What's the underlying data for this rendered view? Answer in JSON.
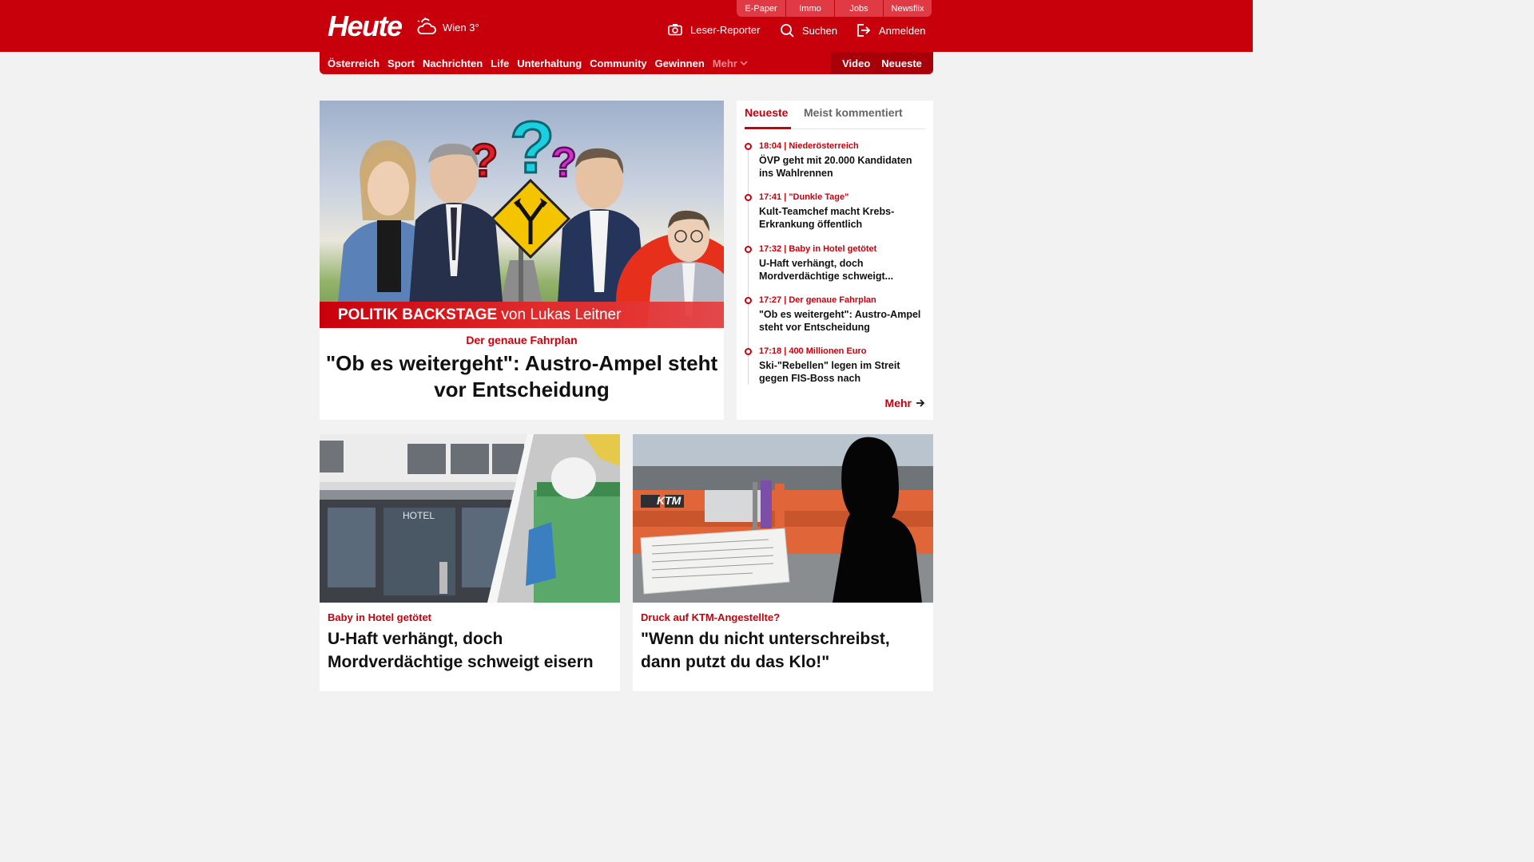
{
  "header": {
    "logo": "Heute",
    "weather": "Wien 3°",
    "weather_icon": "cloud-sun-icon",
    "top_links": [
      "E-Paper",
      "Immo",
      "Jobs",
      "Newsflix"
    ],
    "actions": {
      "reporter": "Leser-Reporter",
      "search": "Suchen",
      "login": "Anmelden"
    }
  },
  "nav": {
    "items": [
      "Österreich",
      "Sport",
      "Nachrichten",
      "Life",
      "Unterhaltung",
      "Community",
      "Gewinnen"
    ],
    "more": "Mehr",
    "right": [
      "Video",
      "Neueste"
    ]
  },
  "hero": {
    "banner_bold": "POLITIK BACKSTAGE",
    "banner_rest": " von Lukas Leitner",
    "kicker": "Der genaue Fahrplan",
    "title": "\"Ob es weitergeht\": Austro-Ampel steht vor Entscheidung"
  },
  "sidebar": {
    "tabs": [
      "Neueste",
      "Meist kommentiert"
    ],
    "items": [
      {
        "meta": "18:04 | Niederösterreich",
        "title": "ÖVP geht mit 20.000 Kandidaten ins Wahlrennen"
      },
      {
        "meta": "17:41 | \"Dunkle Tage\"",
        "title": "Kult-Teamchef macht Krebs-Erkrankung öffentlich"
      },
      {
        "meta": "17:32 | Baby in Hotel getötet",
        "title": "U-Haft verhängt, doch Mordverdächtige schweigt..."
      },
      {
        "meta": "17:27 | Der genaue Fahrplan",
        "title": "\"Ob es weitergeht\": Austro-Ampel steht vor Entscheidung"
      },
      {
        "meta": "17:18 | 400 Millionen Euro",
        "title": "Ski-\"Rebellen\" legen im Streit gegen FIS-Boss nach"
      }
    ],
    "more": "Mehr"
  },
  "cards": [
    {
      "kicker": "Baby in Hotel getötet",
      "title": "U-Haft verhängt, doch Mordverdächtige schweigt eisern",
      "image_sign": "HOTEL"
    },
    {
      "kicker": "Druck auf KTM-Angestellte?",
      "title": "\"Wenn du nicht unterschreibst, dann putzt du das Klo!\"",
      "image_sign": "KTM"
    }
  ],
  "colors": {
    "brand_red": "#c8000c",
    "dark_red": "#a8000a",
    "background": "#f2f2f2"
  }
}
